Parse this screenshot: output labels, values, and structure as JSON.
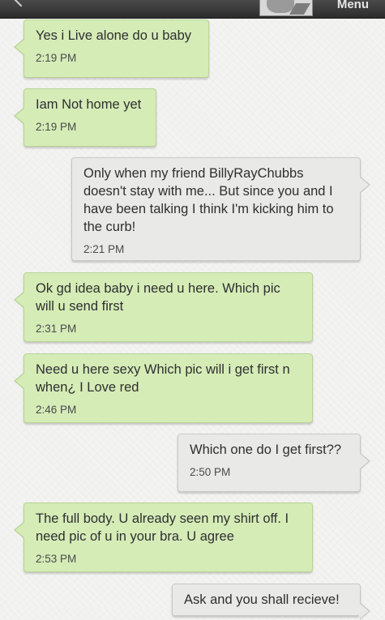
{
  "header": {
    "menu_label": "Menu",
    "back_icon": "back-arrow-icon",
    "avatar_icon": "contact-avatar-icon"
  },
  "colors": {
    "incoming_bubble": "#d5ecb7",
    "outgoing_bubble": "#e9e9e7",
    "header_bar": "#2c2c2c"
  },
  "messages": [
    {
      "direction": "incoming",
      "text": "Yes i Live alone do u baby",
      "time": "2:19 PM"
    },
    {
      "direction": "incoming",
      "text": "Iam Not home yet",
      "time": "2:19 PM"
    },
    {
      "direction": "outgoing",
      "text": "Only when my friend BillyRayChubbs\ndoesn't stay with me... But since you and I\nhave been talking I think I'm kicking him to\nthe curb!",
      "time": "2:21 PM"
    },
    {
      "direction": "incoming",
      "text": "Ok gd idea baby i need u here. Which pic\nwill u send first",
      "time": "2:31 PM"
    },
    {
      "direction": "incoming",
      "text": "Need u here sexy Which pic will i get first n\nwhen¿ I Love red",
      "time": "2:46 PM"
    },
    {
      "direction": "outgoing",
      "text": "Which one do I get first??",
      "time": "2:50 PM"
    },
    {
      "direction": "incoming",
      "text": "The full body. U already seen my shirt off. I\nneed pic of u in your bra. U agree",
      "time": "2:53 PM"
    },
    {
      "direction": "outgoing",
      "text": "Ask and you shall recieve!",
      "time": ""
    }
  ]
}
